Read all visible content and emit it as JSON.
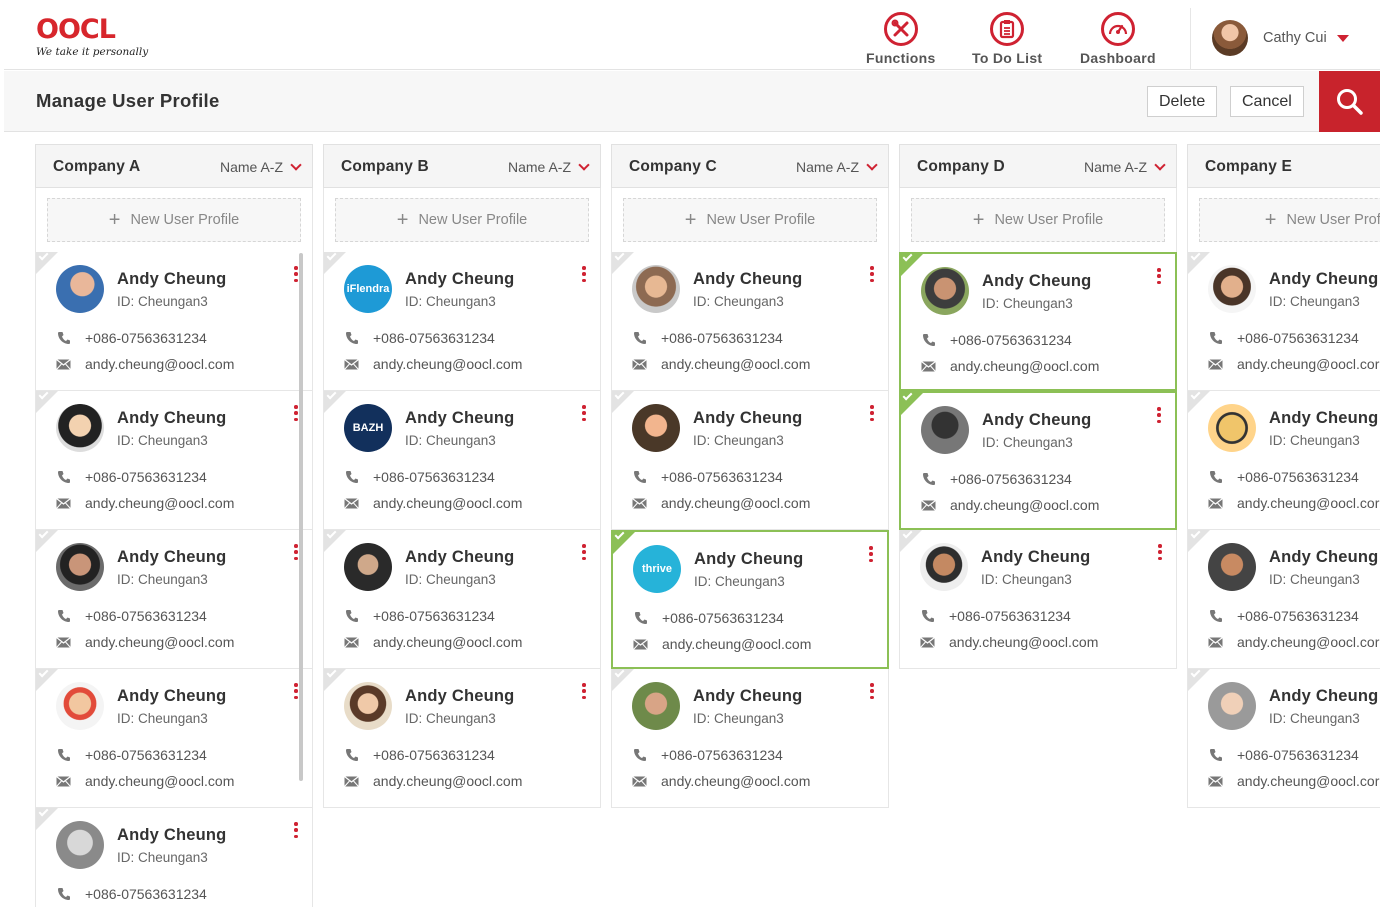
{
  "brand": {
    "logo_text": "OOCL",
    "tagline": "We take it personally"
  },
  "nav": [
    {
      "label": "Functions",
      "icon": "functions-icon"
    },
    {
      "label": "To Do List",
      "icon": "todo-list-icon"
    },
    {
      "label": "Dashboard",
      "icon": "dashboard-icon"
    }
  ],
  "user": {
    "name": "Cathy Cui"
  },
  "page": {
    "title": "Manage User Profile",
    "delete_label": "Delete",
    "cancel_label": "Cancel"
  },
  "colors": {
    "accent": "#c8232c",
    "selected": "#8cc056"
  },
  "columns": [
    {
      "name": "Company A",
      "sort": "Name A-Z",
      "new_label": "New User Profile",
      "cards": [
        {
          "name": "Andy Cheung",
          "id": "ID: Cheungan3",
          "phone": "+086-07563631234",
          "email": "andy.cheung@oocl.com",
          "selected": false,
          "avatar": "photo"
        },
        {
          "name": "Andy Cheung",
          "id": "ID: Cheungan3",
          "phone": "+086-07563631234",
          "email": "andy.cheung@oocl.com",
          "selected": false,
          "avatar": "photo"
        },
        {
          "name": "Andy Cheung",
          "id": "ID: Cheungan3",
          "phone": "+086-07563631234",
          "email": "andy.cheung@oocl.com",
          "selected": false,
          "avatar": "photo"
        },
        {
          "name": "Andy Cheung",
          "id": "ID: Cheungan3",
          "phone": "+086-07563631234",
          "email": "andy.cheung@oocl.com",
          "selected": false,
          "avatar": "photo"
        },
        {
          "name": "Andy Cheung",
          "id": "ID: Cheungan3",
          "phone": "+086-07563631234",
          "email": "",
          "selected": false,
          "avatar": "photo"
        }
      ]
    },
    {
      "name": "Company B",
      "sort": "Name A-Z",
      "new_label": "New User Profile",
      "cards": [
        {
          "name": "Andy Cheung",
          "id": "ID: Cheungan3",
          "phone": "+086-07563631234",
          "email": "andy.cheung@oocl.com",
          "selected": false,
          "avatar": "logo",
          "avatar_text": "iFlendra"
        },
        {
          "name": "Andy Cheung",
          "id": "ID: Cheungan3",
          "phone": "+086-07563631234",
          "email": "andy.cheung@oocl.com",
          "selected": false,
          "avatar": "logo",
          "avatar_text": "BAZH"
        },
        {
          "name": "Andy Cheung",
          "id": "ID: Cheungan3",
          "phone": "+086-07563631234",
          "email": "andy.cheung@oocl.com",
          "selected": false,
          "avatar": "photo"
        },
        {
          "name": "Andy Cheung",
          "id": "ID: Cheungan3",
          "phone": "+086-07563631234",
          "email": "andy.cheung@oocl.com",
          "selected": false,
          "avatar": "photo"
        }
      ]
    },
    {
      "name": "Company C",
      "sort": "Name A-Z",
      "new_label": "New User Profile",
      "cards": [
        {
          "name": "Andy Cheung",
          "id": "ID: Cheungan3",
          "phone": "+086-07563631234",
          "email": "andy.cheung@oocl.com",
          "selected": false,
          "avatar": "photo"
        },
        {
          "name": "Andy Cheung",
          "id": "ID: Cheungan3",
          "phone": "+086-07563631234",
          "email": "andy.cheung@oocl.com",
          "selected": false,
          "avatar": "photo"
        },
        {
          "name": "Andy Cheung",
          "id": "ID: Cheungan3",
          "phone": "+086-07563631234",
          "email": "andy.cheung@oocl.com",
          "selected": true,
          "avatar": "logo",
          "avatar_text": "thrive"
        },
        {
          "name": "Andy Cheung",
          "id": "ID: Cheungan3",
          "phone": "+086-07563631234",
          "email": "andy.cheung@oocl.com",
          "selected": false,
          "avatar": "photo"
        }
      ]
    },
    {
      "name": "Company D",
      "sort": "Name A-Z",
      "new_label": "New User Profile",
      "cards": [
        {
          "name": "Andy Cheung",
          "id": "ID: Cheungan3",
          "phone": "+086-07563631234",
          "email": "andy.cheung@oocl.com",
          "selected": true,
          "avatar": "photo"
        },
        {
          "name": "Andy Cheung",
          "id": "ID: Cheungan3",
          "phone": "+086-07563631234",
          "email": "andy.cheung@oocl.com",
          "selected": true,
          "avatar": "photo"
        },
        {
          "name": "Andy Cheung",
          "id": "ID: Cheungan3",
          "phone": "+086-07563631234",
          "email": "andy.cheung@oocl.com",
          "selected": false,
          "avatar": "photo"
        }
      ]
    },
    {
      "name": "Company E",
      "sort": "",
      "new_label": "New User Profil",
      "cards": [
        {
          "name": "Andy Cheung",
          "id": "ID: Cheungan3",
          "phone": "+086-07563631234",
          "email": "andy.cheung@oocl.cor",
          "selected": false,
          "avatar": "photo"
        },
        {
          "name": "Andy Cheung",
          "id": "ID: Cheungan3",
          "phone": "+086-07563631234",
          "email": "andy.cheung@oocl.cor",
          "selected": false,
          "avatar": "photo"
        },
        {
          "name": "Andy Cheung",
          "id": "ID: Cheungan3",
          "phone": "+086-07563631234",
          "email": "andy.cheung@oocl.cor",
          "selected": false,
          "avatar": "photo"
        },
        {
          "name": "Andy Cheung",
          "id": "ID: Cheungan3",
          "phone": "+086-07563631234",
          "email": "andy.cheung@oocl.cor",
          "selected": false,
          "avatar": "photo"
        }
      ]
    }
  ]
}
